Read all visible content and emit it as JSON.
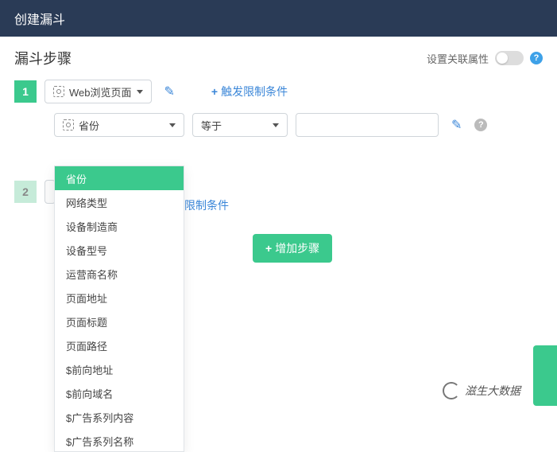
{
  "titlebar": {
    "title": "创建漏斗"
  },
  "section": {
    "title": "漏斗步骤"
  },
  "assoc": {
    "label": "设置关联属性"
  },
  "step1": {
    "number": "1",
    "event_label": "Web浏览页面",
    "trigger_label": "触发限制条件",
    "prop_selected": "省份",
    "op_selected": "等于"
  },
  "dropdown": {
    "items": [
      "省份",
      "网络类型",
      "设备制造商",
      "设备型号",
      "运营商名称",
      "页面地址",
      "页面标题",
      "页面路径",
      "$前向地址",
      "$前向域名",
      "$广告系列内容",
      "$广告系列名称"
    ]
  },
  "step2": {
    "number": "2",
    "trigger_label": "触发限制条件"
  },
  "add_step": {
    "label": "增加步骤"
  },
  "watermark": {
    "text": "滋生大数据"
  }
}
